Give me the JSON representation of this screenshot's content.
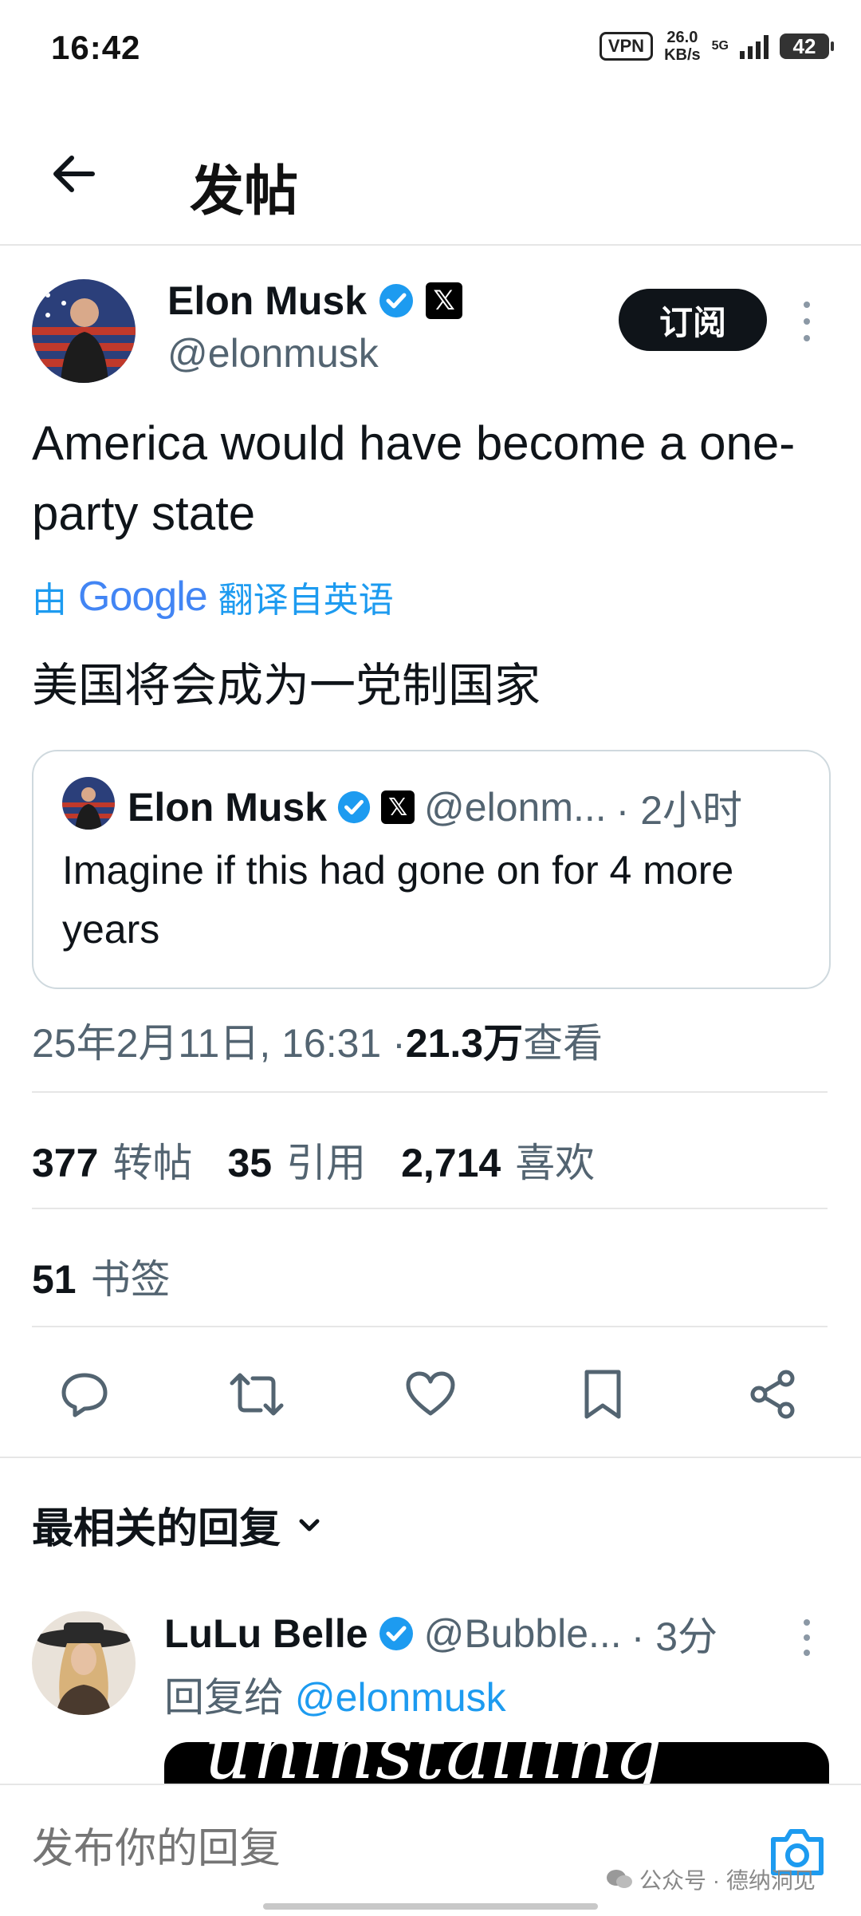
{
  "status_bar": {
    "time": "16:42",
    "vpn": "VPN",
    "speed_value": "26.0",
    "speed_unit": "KB/s",
    "network": "5G",
    "battery": "42"
  },
  "header": {
    "title": "发帖",
    "back_icon": "arrow-left-icon"
  },
  "post": {
    "author_name": "Elon Musk",
    "author_handle": "@elonmusk",
    "subscribe_label": "订阅",
    "text": "America would have become a one-party state",
    "translate_prefix": "由",
    "translate_brand": "Google",
    "translate_suffix": "翻译自英语",
    "translated_text": "美国将会成为一党制国家",
    "quote": {
      "author_name": "Elon Musk",
      "author_handle": "@elonm...",
      "time": "· 2小时",
      "text": "Imagine if this had gone on for 4 more years"
    },
    "meta": {
      "timestamp": "25年2月11日, 16:31 · ",
      "views_count": "21.3万",
      "views_label": " 查看"
    },
    "stats": {
      "reposts_count": "377",
      "reposts_label": "转帖",
      "quotes_count": "35",
      "quotes_label": "引用",
      "likes_count": "2,714",
      "likes_label": "喜欢",
      "bookmarks_count": "51",
      "bookmarks_label": "书签"
    }
  },
  "replies": {
    "heading": "最相关的回复",
    "items": [
      {
        "author_name": "LuLu Belle",
        "author_handle": "@Bubble...",
        "time": "· 3分",
        "reply_to_prefix": "回复给 ",
        "reply_to_handle": "@elonmusk",
        "media_text": "uninstalling"
      }
    ]
  },
  "composer": {
    "placeholder": "发布你的回复"
  },
  "watermark": "公众号 · 德纳洞见",
  "colors": {
    "accent": "#1d9bf0",
    "text": "#0f1419",
    "secondary": "#536471",
    "border": "#cfd9de"
  }
}
